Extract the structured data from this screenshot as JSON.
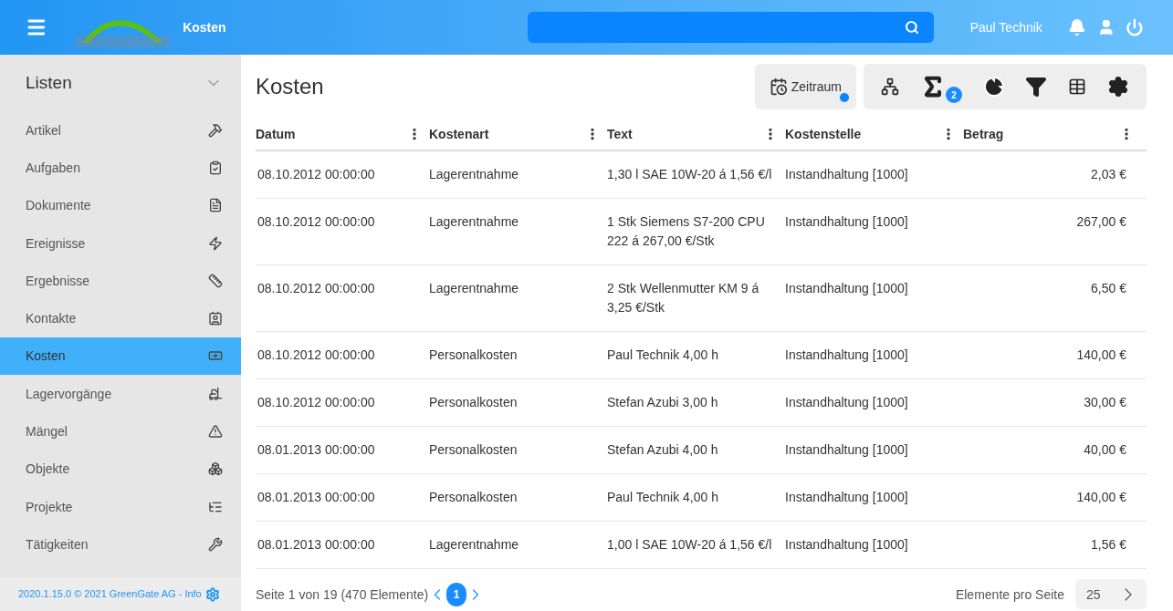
{
  "header": {
    "page_title": "Kosten",
    "user": "Paul Technik"
  },
  "sidebar": {
    "title": "Listen",
    "items": [
      {
        "label": "Artikel",
        "selected": false
      },
      {
        "label": "Aufgaben",
        "selected": false
      },
      {
        "label": "Dokumente",
        "selected": false
      },
      {
        "label": "Ereignisse",
        "selected": false
      },
      {
        "label": "Ergebnisse",
        "selected": false
      },
      {
        "label": "Kontakte",
        "selected": false
      },
      {
        "label": "Kosten",
        "selected": true
      },
      {
        "label": "Lagervorgänge",
        "selected": false
      },
      {
        "label": "Mängel",
        "selected": false
      },
      {
        "label": "Objekte",
        "selected": false
      },
      {
        "label": "Projekte",
        "selected": false
      },
      {
        "label": "Tätigkeiten",
        "selected": false
      }
    ],
    "footer": "2020.1.15.0 © 2021 GreenGate AG - Info"
  },
  "main": {
    "title": "Kosten",
    "toolbar": {
      "period_button": "Zeitraum",
      "period_active": true,
      "sum_badge": "2"
    },
    "table": {
      "columns": [
        "Datum",
        "Kostenart",
        "Text",
        "Kostenstelle",
        "Betrag"
      ],
      "rows": [
        [
          "08.10.2012 00:00:00",
          "Lagerentnahme",
          "1,30 l SAE 10W-20 á 1,56 €/l",
          "Instandhaltung [1000]",
          "2,03 €"
        ],
        [
          "08.10.2012 00:00:00",
          "Lagerentnahme",
          "1 Stk Siemens S7-200 CPU 222 á 267,00 €/Stk",
          "Instandhaltung [1000]",
          "267,00 €"
        ],
        [
          "08.10.2012 00:00:00",
          "Lagerentnahme",
          "2 Stk Wellenmutter KM 9 á 3,25 €/Stk",
          "Instandhaltung [1000]",
          "6,50 €"
        ],
        [
          "08.10.2012 00:00:00",
          "Personalkosten",
          "Paul Technik 4,00 h",
          "Instandhaltung [1000]",
          "140,00 €"
        ],
        [
          "08.10.2012 00:00:00",
          "Personalkosten",
          "Stefan Azubi 3,00 h",
          "Instandhaltung [1000]",
          "30,00 €"
        ],
        [
          "08.01.2013 00:00:00",
          "Personalkosten",
          "Stefan Azubi 4,00 h",
          "Instandhaltung [1000]",
          "40,00 €"
        ],
        [
          "08.01.2013 00:00:00",
          "Personalkosten",
          "Paul Technik 4,00 h",
          "Instandhaltung [1000]",
          "140,00 €"
        ],
        [
          "08.01.2013 00:00:00",
          "Lagerentnahme",
          "1,00 l SAE 10W-20 á 1,56 €/l",
          "Instandhaltung [1000]",
          "1,56 €"
        ]
      ]
    },
    "pager": {
      "summary": "Seite 1 von 19 (470 Elemente)",
      "pages": [
        {
          "label": "1",
          "selected": true
        }
      ],
      "per_page_label": "Elemente pro Seite",
      "per_page": "25"
    }
  }
}
